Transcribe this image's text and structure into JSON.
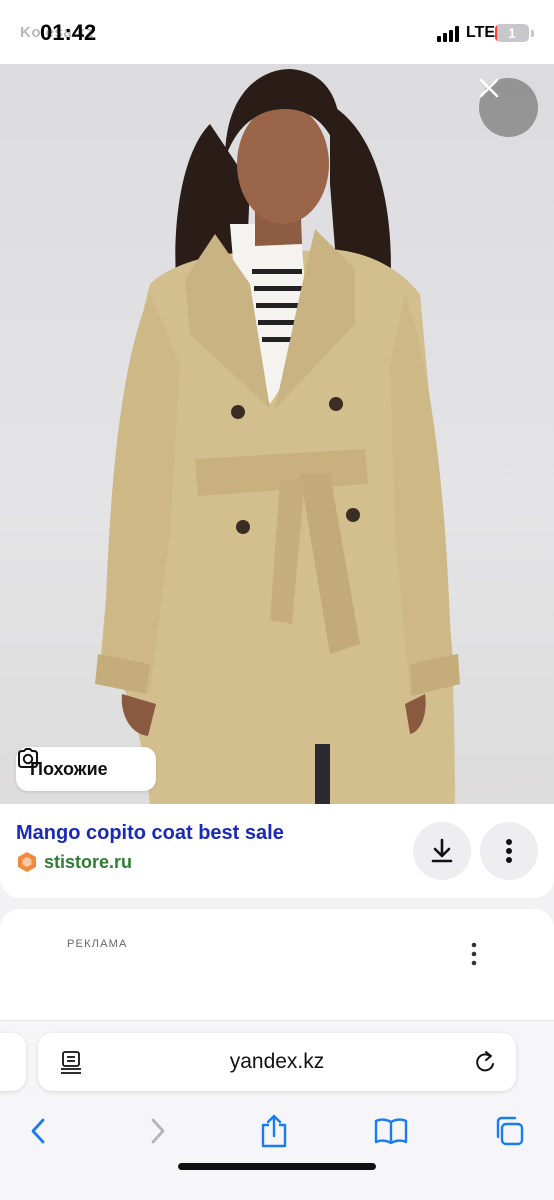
{
  "status_bar": {
    "time": "01:42",
    "watermark": "Kolesa.kz",
    "network": "LTE",
    "battery_level": "1",
    "battery_fraction": 0.06
  },
  "photo": {
    "description_icon": "close-icon"
  },
  "similar_button": {
    "label": "Похожие",
    "icon": "lens-icon"
  },
  "result": {
    "title": "Mango copito coat best sale",
    "site": "stistore.ru",
    "site_icon": "hexagon-icon",
    "download_icon": "download-icon",
    "more_icon": "more-vertical-icon"
  },
  "ad": {
    "label": "РЕКЛАМА"
  },
  "browser": {
    "url": "yandex.kz",
    "toolbar": [
      "back-icon",
      "forward-icon",
      "share-icon",
      "bookmarks-icon",
      "tabs-icon"
    ]
  },
  "colors": {
    "title_link": "#1a2ab8",
    "site_green": "#2f7d32",
    "safari_blue": "#1a7cf2",
    "coat": "#d3bf8e"
  }
}
